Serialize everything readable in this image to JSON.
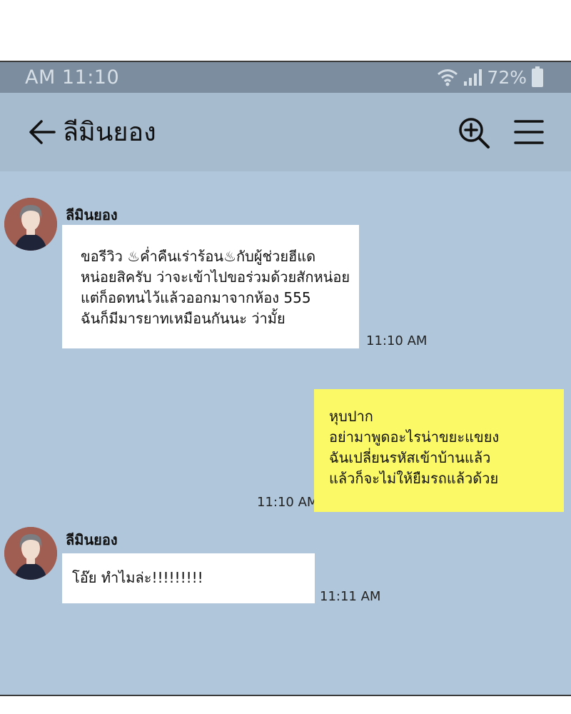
{
  "status_bar": {
    "time": "AM 11:10",
    "battery": "72%",
    "icons": [
      "wifi-icon",
      "signal-icon",
      "battery-icon"
    ]
  },
  "header": {
    "title": "ลีมินยอง",
    "back_icon": "arrow-left-icon",
    "search_icon": "zoom-in-icon",
    "menu_icon": "hamburger-menu-icon"
  },
  "messages": [
    {
      "direction": "incoming",
      "sender": "ลีมินยอง",
      "lines": [
        "ขอรีวิว ♨ค่ำคืนเร่าร้อน♨กับผู้ช่วยฮีแด",
        "หน่อยสิครับ ว่าจะเข้าไปขอร่วมด้วยสักหน่อย",
        "แต่ก็อดทนไว้แล้วออกมาจากห้อง 555",
        "ฉันก็มีมารยาทเหมือนกันนะ ว่ามั้ย"
      ],
      "time": "11:10 AM"
    },
    {
      "direction": "outgoing",
      "lines": [
        "หุบปาก",
        "อย่ามาพูดอะไรน่าขยะแขยง",
        "ฉันเปลี่ยนรหัสเข้าบ้านแล้ว",
        "แล้วก็จะไม่ให้ยืมรถแล้วด้วย"
      ],
      "time": "11:10 AM"
    },
    {
      "direction": "incoming",
      "sender": "ลีมินยอง",
      "lines": [
        "โอ๊ย ทำไมล่ะ!!!!!!!!!"
      ],
      "time": "11:11 AM"
    }
  ],
  "colors": {
    "status_bar": "#7c8d9f",
    "header": "#a7bbcf",
    "chat_background": "#b0c6da",
    "incoming_bubble": "#ffffff",
    "outgoing_bubble": "#fbf966"
  }
}
